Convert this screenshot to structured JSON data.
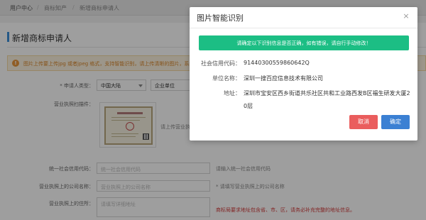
{
  "breadcrumb": {
    "items": [
      "用户中心",
      "商标知产",
      "新增商标申请人"
    ],
    "separator": "/"
  },
  "page": {
    "title": "新增商标申请人",
    "notice": "图片上传要上传jpg 或者jpeg 格式，支持智能识别，请上传清晰的图片，系统..."
  },
  "form": {
    "applicant_type": {
      "label": "* 申请人类型：",
      "country_value": "中国大陆",
      "entity_value": "企业单位"
    },
    "license_scan": {
      "label": "营业执照扫描件：",
      "hint": "请上传营业执..."
    },
    "credit_code": {
      "label": "统一社会信用代码：",
      "placeholder": "统一社会信用代码",
      "hint": "请输入统一社会信用代码"
    },
    "company_name": {
      "label": "营业执照上的公司名称：",
      "placeholder": "营业执照上的公司名称",
      "hint": "* 请填写营业执照上的公司名称"
    },
    "address": {
      "label": "营业执照上的住所：",
      "placeholder": "请填写详细地址",
      "hint": "商标局要求地址包含省、市、区，请务必补充完整的地址信息。"
    }
  },
  "dialog": {
    "title": "图片智能识别",
    "close_glyph": "×",
    "alert": "请确定以下识别信息是否正确，如有错误，请自行手动修改！",
    "fields": [
      {
        "label": "社会信用代码：",
        "value": "91440300559860642Q"
      },
      {
        "label": "单位名称：",
        "value": "深圳一搜百应信息技术有限公司"
      },
      {
        "label": "地址：",
        "value": "深圳市宝安区西乡街道共乐社区共和工业路西发B区福生研发大厦2",
        "value_cont": "0层"
      }
    ],
    "cancel_label": "取消",
    "confirm_label": "确定"
  },
  "colors": {
    "success_alert": "#1cbe84",
    "cancel_button": "#ea5d5d",
    "confirm_button": "#3b80d3",
    "notice_bg": "#fcf3df",
    "notice_text": "#d9862b",
    "warning_text": "#d23b3b"
  },
  "icons": [
    "warning-icon",
    "close-icon",
    "chevron-down-icon",
    "license-image"
  ]
}
